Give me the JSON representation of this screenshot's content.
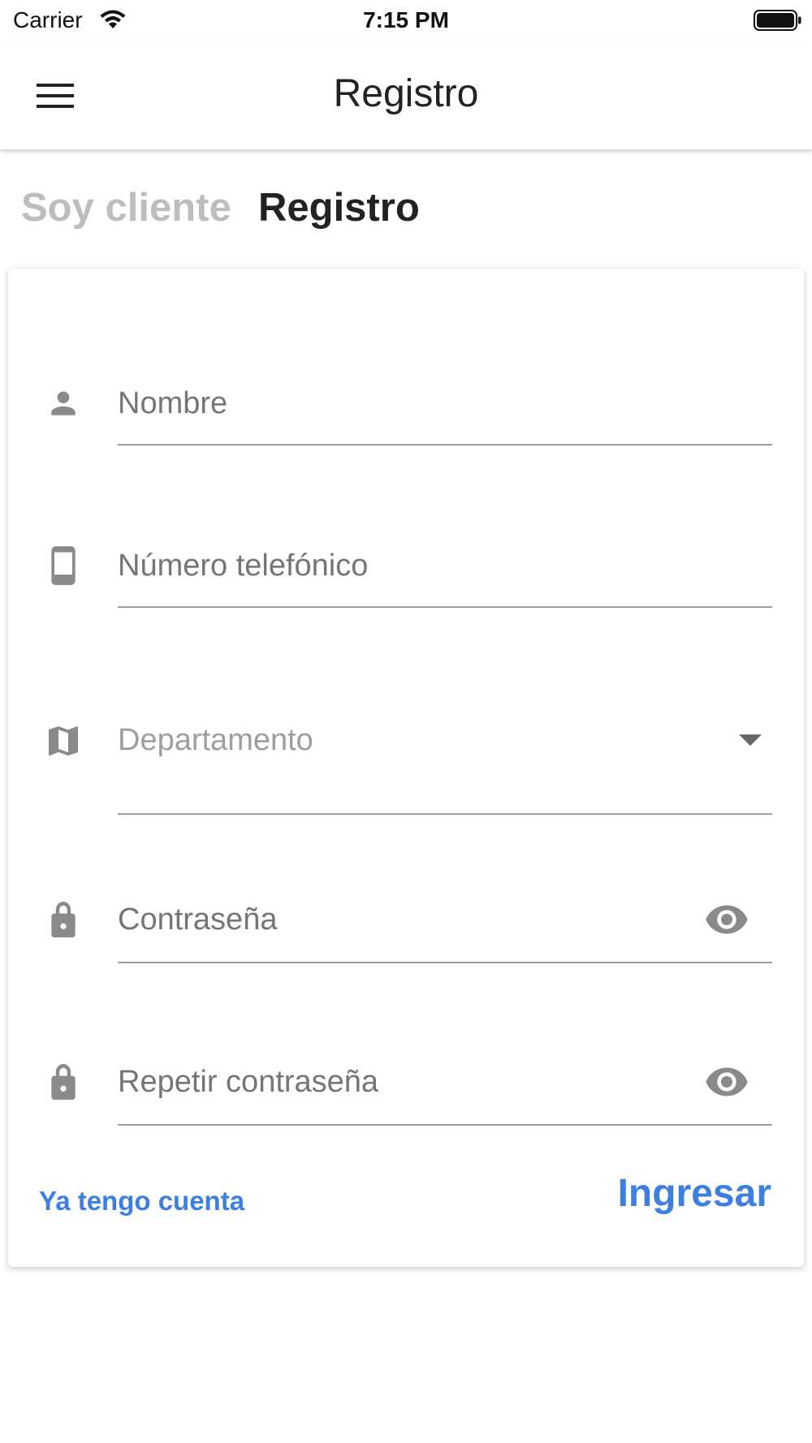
{
  "status_bar": {
    "carrier": "Carrier",
    "time": "7:15 PM"
  },
  "app_bar": {
    "title": "Registro",
    "menu_icon": "hamburger-menu-icon"
  },
  "tabs": {
    "inactive_label": "Soy cliente",
    "active_label": "Registro"
  },
  "form": {
    "fields": [
      {
        "icon": "person-icon",
        "placeholder": "Nombre",
        "value": ""
      },
      {
        "icon": "phone-icon",
        "placeholder": "Número telefónico",
        "value": ""
      },
      {
        "icon": "map-icon",
        "placeholder": "Departamento",
        "type": "dropdown",
        "value": ""
      },
      {
        "icon": "lock-icon",
        "placeholder": "Contraseña",
        "value": "",
        "suffix_icon": "eye-icon"
      },
      {
        "icon": "lock-icon",
        "placeholder": "Repetir contraseña",
        "value": "",
        "suffix_icon": "eye-icon"
      }
    ],
    "have_account_link": "Ya tengo cuenta",
    "submit_label": "Ingresar"
  },
  "colors": {
    "accent": "#3d7fe0",
    "inactive_tab": "#bdbdbd",
    "icon_gray": "#8a8a8a",
    "underline": "#9e9e9e"
  }
}
